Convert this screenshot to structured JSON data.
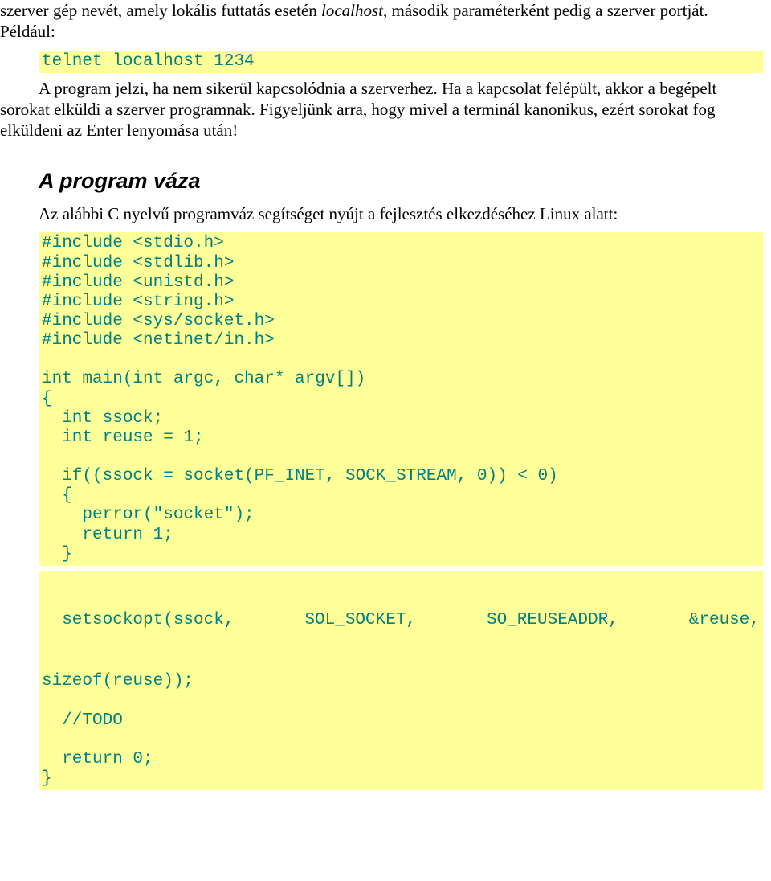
{
  "intro_para": {
    "pre": "szerver gép nevét, amely lokális futtatás esetén ",
    "italic": "localhost",
    "post": ", második paraméterként pedig a szerver portját. Például:"
  },
  "code1": "telnet localhost 1234",
  "after_code1": "A program jelzi, ha nem sikerül kapcsolódnia a szerverhez. Ha a kapcsolat felépült, akkor a begépelt sorokat elküldi a szerver programnak. Figyeljünk arra, hogy mivel a terminál kanonikus, ezért sorokat fog elküldeni az Enter lenyomása után!",
  "section_title": "A program váza",
  "section_intro": "Az alábbi C nyelvű programváz segítséget nyújt a fejlesztés elkezdéséhez Linux alatt:",
  "code2": "#include <stdio.h>\n#include <stdlib.h>\n#include <unistd.h>\n#include <string.h>\n#include <sys/socket.h>\n#include <netinet/in.h>\n\nint main(int argc, char* argv[])\n{\n  int ssock;\n  int reuse = 1;\n\n  if((ssock = socket(PF_INET, SOCK_STREAM, 0)) < 0)\n  {\n    perror(\"socket\");\n    return 1;\n  }\n",
  "setsock": {
    "a": "  setsockopt(ssock,",
    "b": "SOL_SOCKET,",
    "c": "SO_REUSEADDR,",
    "d": "&reuse,"
  },
  "code3": "sizeof(reuse));\n\n  //TODO\n\n  return 0;\n}"
}
